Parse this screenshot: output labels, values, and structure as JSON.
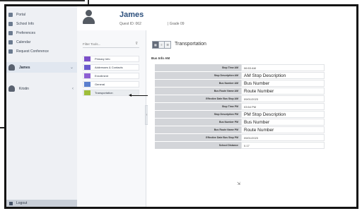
{
  "sidebar": {
    "items": [
      {
        "label": "Portal",
        "icon": "home-icon"
      },
      {
        "label": "School Info",
        "icon": "info-icon"
      },
      {
        "label": "Preferences",
        "icon": "gear-icon"
      },
      {
        "label": "Calendar",
        "icon": "calendar-icon"
      },
      {
        "label": "Request Conference",
        "icon": "conference-icon"
      }
    ],
    "user_current": "James",
    "user_other": "Kristin",
    "logout": "Logout"
  },
  "header": {
    "name": "James",
    "id": "Quest ID: 062",
    "grade": "| Grade 09"
  },
  "menu": {
    "filter_placeholder": "Filter Tools...",
    "items": [
      {
        "label": "Primary Info",
        "color": "#7b4fc9"
      },
      {
        "label": "Addresses & Contacts",
        "color": "#6a5acd"
      },
      {
        "label": "Enrollment",
        "color": "#8d5fd3"
      },
      {
        "label": "General",
        "color": "#5b7fce"
      },
      {
        "label": "Transportation",
        "color": "#9fbe3a"
      }
    ],
    "callout": "3"
  },
  "main": {
    "title": "Transportation",
    "subtitle": "Bus Info AM",
    "rows": [
      {
        "key": "Stop Time AM",
        "value": "06:53 AM",
        "big": false
      },
      {
        "key": "Stop Description AM",
        "value": "AM Stop Description",
        "big": true
      },
      {
        "key": "Bus Number AM",
        "value": "Bus Number",
        "big": true
      },
      {
        "key": "Bus Route Name AM",
        "value": "Route Number",
        "big": true
      },
      {
        "key": "Effective Date Bus Stop AM",
        "value": "09/01/2023",
        "big": false
      },
      {
        "key": "Stop Time PM",
        "value": "03:54 PM",
        "big": false
      },
      {
        "key": "Stop Description PM",
        "value": "PM Stop Description",
        "big": true
      },
      {
        "key": "Bus Number PM",
        "value": "Bus Number",
        "big": true
      },
      {
        "key": "Bus Route Name PM",
        "value": "Route Number",
        "big": true
      },
      {
        "key": "Effective Date Bus Stop PM",
        "value": "09/01/2023",
        "big": false
      },
      {
        "key": "School Distance",
        "value": "0.17",
        "big": false
      }
    ]
  }
}
